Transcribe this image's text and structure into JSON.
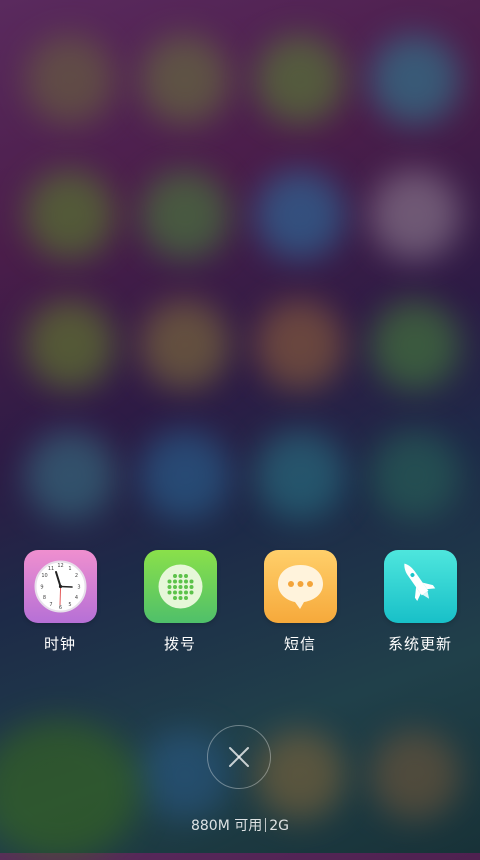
{
  "recent_apps": [
    {
      "label": "时钟",
      "icon": "clock-icon",
      "color_top": "#ef8fcf",
      "color_bottom": "#b670d6"
    },
    {
      "label": "拨号",
      "icon": "phone-dialer-icon",
      "color_top": "#8ae04a",
      "color_bottom": "#4fc06a"
    },
    {
      "label": "短信",
      "icon": "message-bubble-icon",
      "color_top": "#ffcf6a",
      "color_bottom": "#f6a93b"
    },
    {
      "label": "系统更新",
      "icon": "rocket-icon",
      "color_top": "#4ee6dd",
      "color_bottom": "#18c0c8"
    }
  ],
  "close_button": {
    "icon": "close-icon"
  },
  "memory": {
    "available": "880M 可用",
    "total": "2G"
  }
}
